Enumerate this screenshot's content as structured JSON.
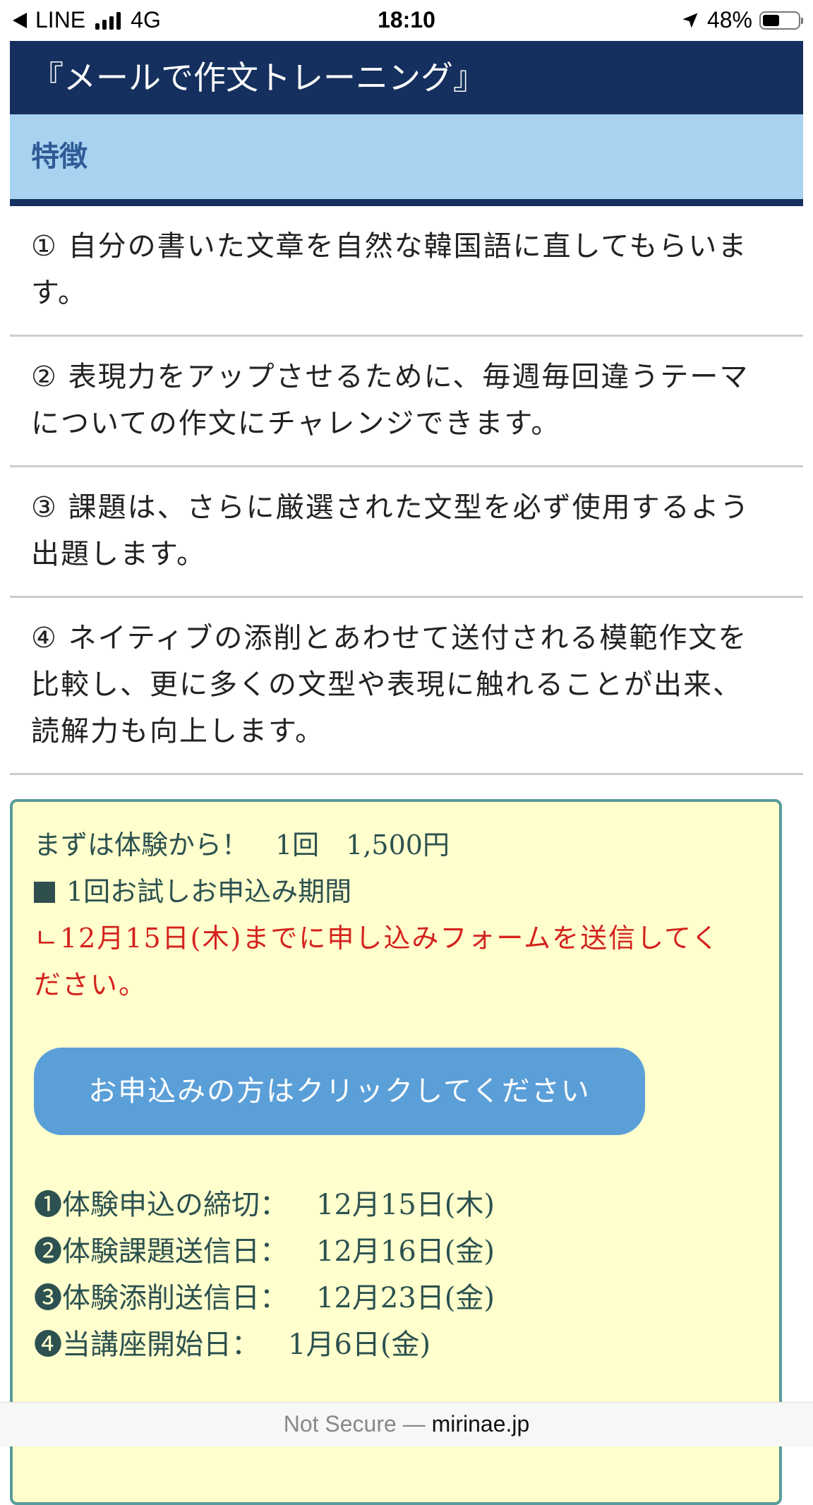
{
  "status_bar": {
    "back_app": "LINE",
    "network": "4G",
    "time": "18:10",
    "battery_percent": "48%",
    "battery_level": 0.48
  },
  "header": {
    "title": "『メールで作文トレーニング』",
    "subheader": "特徴"
  },
  "features": [
    "① 自分の書いた文章を自然な韓国語に直してもらいます。",
    "② 表現力をアップさせるために、毎週毎回違うテーマについての作文にチャレンジできます。",
    "③ 課題は、さらに厳選された文型を必ず使用するよう出題します。",
    "④ ネイティブの添削とあわせて送付される模範作文を比較し、更に多くの文型や表現に触れることが出来、読解力も向上します。"
  ],
  "notice": {
    "trial_line": "まずは体験から！　1回　1,500円",
    "period_label": "1回お試しお申込み期間",
    "deadline_note": "ㄴ12月15日(木)までに申し込みフォームを送信してください。",
    "apply_button": "お申込みの方はクリックしてください",
    "schedule": [
      {
        "label": "❶体験申込の締切：",
        "value": "12月15日(木)"
      },
      {
        "label": "❷体験課題送信日：",
        "value": "12月16日(金)"
      },
      {
        "label": "❸体験添削送信日：",
        "value": "12月23日(金)"
      },
      {
        "label": "❹当講座開始日：",
        "value": "1月6日(金)"
      }
    ]
  },
  "url_bar": {
    "security": "Not Secure —",
    "domain": "mirinae.jp"
  },
  "colors": {
    "title_bg": "#15305e",
    "subheader_bg": "#a7d3f1",
    "notice_bg": "#ffffcd",
    "notice_border": "#5a9b9a",
    "accent_red": "#d4221d",
    "button_bg": "#5b9fd8"
  }
}
